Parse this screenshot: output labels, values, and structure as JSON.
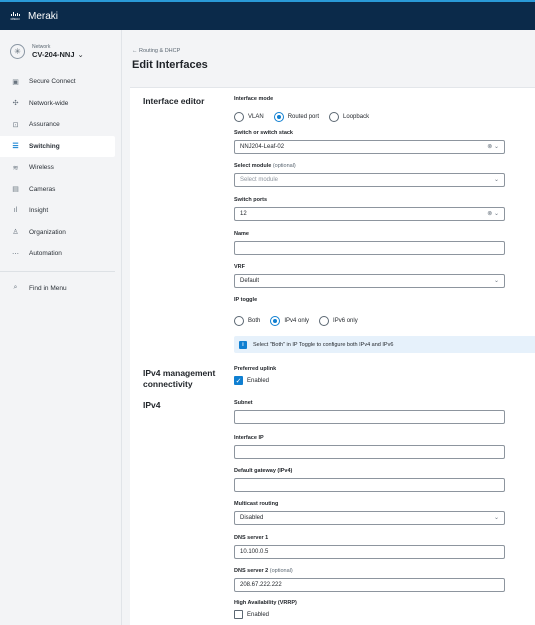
{
  "app": {
    "brand": "Meraki",
    "vendor": "cisco"
  },
  "network": {
    "label": "Network",
    "name": "CV-204-NNJ"
  },
  "nav": [
    {
      "label": "Secure Connect",
      "icon": "shield-icon"
    },
    {
      "label": "Network-wide",
      "icon": "network-icon"
    },
    {
      "label": "Assurance",
      "icon": "assurance-icon"
    },
    {
      "label": "Switching",
      "icon": "switch-icon"
    },
    {
      "label": "Wireless",
      "icon": "wifi-icon"
    },
    {
      "label": "Cameras",
      "icon": "camera-icon"
    },
    {
      "label": "Insight",
      "icon": "chart-icon"
    },
    {
      "label": "Organization",
      "icon": "organization-icon"
    },
    {
      "label": "Automation",
      "icon": "automation-icon"
    }
  ],
  "nav_active": "Switching",
  "find_menu": {
    "label": "Find in Menu",
    "icon": "search-icon"
  },
  "breadcrumb": "← Routing & DHCP",
  "page_title": "Edit Interfaces",
  "sections": {
    "editor": "Interface editor",
    "mgmt": "IPv4 management connectivity",
    "ipv4": "IPv4"
  },
  "form": {
    "interface_mode": {
      "label": "Interface mode",
      "options": [
        "VLAN",
        "Routed port",
        "Loopback"
      ],
      "selected": "Routed port"
    },
    "switch": {
      "label": "Switch or switch stack",
      "value": "NNJ204-Leaf-02"
    },
    "module": {
      "label": "Select module",
      "optional": "(optional)",
      "placeholder": "Select module"
    },
    "ports": {
      "label": "Switch ports",
      "value": "12"
    },
    "name": {
      "label": "Name",
      "value": ""
    },
    "vrf": {
      "label": "VRF",
      "value": "Default"
    },
    "ip_toggle": {
      "label": "IP toggle",
      "options": [
        "Both",
        "IPv4 only",
        "IPv6 only"
      ],
      "selected": "IPv4 only"
    },
    "info": "Select \"Both\" in IP Toggle to configure both IPv4 and IPv6",
    "uplink": {
      "label": "Preferred uplink",
      "checkbox": "Enabled",
      "checked": true
    },
    "subnet": {
      "label": "Subnet",
      "value": ""
    },
    "interface_ip": {
      "label": "Interface IP",
      "value": ""
    },
    "gateway": {
      "label": "Default gateway (IPv4)",
      "value": ""
    },
    "multicast": {
      "label": "Multicast routing",
      "value": "Disabled"
    },
    "dns1": {
      "label": "DNS server 1",
      "value": "10.100.0.5"
    },
    "dns2": {
      "label": "DNS server 2",
      "optional": "(optional)",
      "value": "208.67.222.222"
    },
    "vrrp": {
      "label": "High Availability (VRRP)",
      "checkbox": "Enabled",
      "checked": false
    }
  },
  "colors": {
    "topbar": "#0b2a4a",
    "accent": "#0f7fd1",
    "info_bg": "#e6f1fb"
  }
}
